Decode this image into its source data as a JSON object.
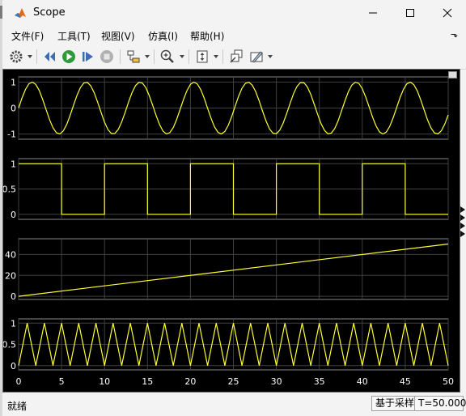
{
  "window": {
    "title": "Scope"
  },
  "menu": {
    "items": [
      "文件(F)",
      "工具(T)",
      "视图(V)",
      "仿真(I)",
      "帮助(H)"
    ],
    "pin_glyph": "⬎"
  },
  "toolbar": {
    "icons": [
      "settings-icon",
      "step-back-icon",
      "run-icon",
      "step-forward-icon",
      "stop-icon",
      "signal-selector-icon",
      "zoom-in-icon",
      "fit-axes-icon",
      "restore-layout-icon",
      "highlight-icon"
    ]
  },
  "colors": {
    "signal": "#ffff33",
    "background": "#000000",
    "grid": "#404040",
    "axis_text": "#ffffff"
  },
  "chart_data": [
    {
      "type": "line",
      "ylim": [
        -1.2,
        1.2
      ],
      "yticks": [
        "-1",
        "0",
        "1"
      ],
      "ytick_values": [
        -1,
        0,
        1
      ],
      "x_sample": [
        0,
        0.4,
        0.8,
        1.2,
        1.6,
        2.0,
        2.4,
        2.8,
        3.2,
        3.6,
        4.0,
        4.4,
        4.8,
        5.2,
        5.6,
        6.0,
        6.4,
        6.8,
        7.2,
        7.6,
        8.0,
        8.4,
        8.8,
        9.2,
        9.6,
        10.0,
        10.4,
        10.8,
        11.2,
        11.6,
        12.0,
        12.4,
        12.8,
        13.2,
        13.6,
        14.0,
        14.4,
        14.8,
        15.2,
        15.6,
        16.0,
        16.4,
        16.8,
        17.2,
        17.6,
        18.0,
        18.4,
        18.8,
        19.2,
        19.6,
        20.0,
        20.4,
        20.8,
        21.2,
        21.6,
        22.0,
        22.4,
        22.8,
        23.2,
        23.6,
        24.0,
        24.4,
        24.8,
        25.2,
        25.6,
        26.0,
        26.4,
        26.8,
        27.2,
        27.6,
        28.0,
        28.4,
        28.8,
        29.2,
        29.6,
        30.0,
        30.4,
        30.8,
        31.2,
        31.6,
        32.0,
        32.4,
        32.8,
        33.2,
        33.6,
        34.0,
        34.4,
        34.8,
        35.2,
        35.6,
        36.0,
        36.4,
        36.8,
        37.2,
        37.6,
        38.0,
        38.4,
        38.8,
        39.2,
        39.6,
        40.0,
        40.4,
        40.8,
        41.2,
        41.6,
        42.0,
        42.4,
        42.8,
        43.2,
        43.6,
        44.0,
        44.4,
        44.8,
        45.2,
        45.6,
        46.0,
        46.4,
        46.8,
        47.2,
        47.6,
        48.0,
        48.4,
        48.8,
        49.2,
        49.6,
        50.0
      ],
      "y": [
        0,
        0.389,
        0.717,
        0.932,
        0.999,
        0.909,
        0.675,
        0.335,
        -0.058,
        -0.443,
        -0.757,
        -0.952,
        -0.996,
        -0.883,
        -0.631,
        -0.279,
        0.117,
        0.494,
        0.794,
        0.968,
        0.989,
        0.855,
        0.585,
        0.223,
        -0.174,
        -0.544,
        -0.828,
        -0.981,
        -0.979,
        -0.823,
        -0.537,
        -0.165,
        0.23,
        0.591,
        0.859,
        0.99,
        0.966,
        0.79,
        0.487,
        0.107,
        -0.285,
        -0.636,
        -0.886,
        -0.997,
        -0.949,
        -0.751,
        -0.435,
        -0.048,
        0.34,
        0.679,
        0.913,
        0.999,
        0.929,
        0.71,
        0.38,
        -0.01,
        -0.397,
        -0.723,
        -0.934,
        -0.998,
        -0.905,
        -0.668,
        -0.327,
        0.068,
        0.452,
        0.763,
        0.955,
        0.995,
        0.88,
        0.625,
        0.271,
        -0.126,
        -0.503,
        -0.8,
        -0.97,
        -0.988,
        -0.851,
        -0.578,
        -0.214,
        0.182,
        0.551,
        0.832,
        0.982,
        0.978,
        0.819,
        0.53,
        0.156,
        -0.239,
        -0.598,
        -0.863,
        -0.991,
        -0.964,
        -0.785,
        -0.479,
        -0.098,
        0.295,
        0.643,
        0.89,
        0.997,
        0.946,
        0.745,
        0.427,
        0.039,
        -0.349,
        -0.686,
        -0.916,
        -1.0,
        -0.926,
        -0.702,
        -0.37,
        0.02,
        0.405,
        0.73,
        0.937,
        0.998,
        0.901,
        0.662,
        0.319,
        -0.078,
        -0.46,
        -0.769,
        -0.957,
        -0.994,
        -0.876,
        -0.618,
        -0.262
      ]
    },
    {
      "type": "line",
      "ylim": [
        -0.1,
        1.1
      ],
      "yticks": [
        "0",
        "0.5",
        "1"
      ],
      "ytick_values": [
        0,
        0.5,
        1
      ],
      "x": [
        0,
        5,
        5,
        10,
        10,
        15,
        15,
        20,
        20,
        25,
        25,
        30,
        30,
        35,
        35,
        40,
        40,
        45,
        45,
        50
      ],
      "y": [
        1,
        1,
        0,
        0,
        1,
        1,
        0,
        0,
        1,
        1,
        0,
        0,
        1,
        1,
        0,
        0,
        1,
        1,
        0,
        0
      ]
    },
    {
      "type": "line",
      "ylim": [
        -3,
        55
      ],
      "yticks": [
        "0",
        "20",
        "40"
      ],
      "ytick_values": [
        0,
        20,
        40
      ],
      "x": [
        0,
        50
      ],
      "y": [
        0,
        50
      ]
    },
    {
      "type": "line",
      "ylim": [
        -0.1,
        1.1
      ],
      "yticks": [
        "0",
        "0.5",
        "1"
      ],
      "ytick_values": [
        0,
        0.5,
        1
      ],
      "x": [
        0,
        1,
        2,
        3,
        4,
        5,
        6,
        7,
        8,
        9,
        10,
        11,
        12,
        13,
        14,
        15,
        16,
        17,
        18,
        19,
        20,
        21,
        22,
        23,
        24,
        25,
        26,
        27,
        28,
        29,
        30,
        31,
        32,
        33,
        34,
        35,
        36,
        37,
        38,
        39,
        40,
        41,
        42,
        43,
        44,
        45,
        46,
        47,
        48,
        49,
        50
      ],
      "y": [
        0,
        1,
        0,
        1,
        0,
        1,
        0,
        1,
        0,
        1,
        0,
        1,
        0,
        1,
        0,
        1,
        0,
        1,
        0,
        1,
        0,
        1,
        0,
        1,
        0,
        1,
        0,
        1,
        0,
        1,
        0,
        1,
        0,
        1,
        0,
        1,
        0,
        1,
        0,
        1,
        0,
        1,
        0,
        1,
        0,
        1,
        0,
        1,
        0,
        1,
        0
      ]
    }
  ],
  "xaxis": {
    "xlim": [
      0,
      50
    ],
    "ticks": [
      "0",
      "5",
      "10",
      "15",
      "20",
      "25",
      "30",
      "35",
      "40",
      "45",
      "50"
    ],
    "tick_values": [
      0,
      5,
      10,
      15,
      20,
      25,
      30,
      35,
      40,
      45,
      50
    ]
  },
  "status": {
    "left": "就绪",
    "mode": "基于采样",
    "time": "T=50.000"
  }
}
